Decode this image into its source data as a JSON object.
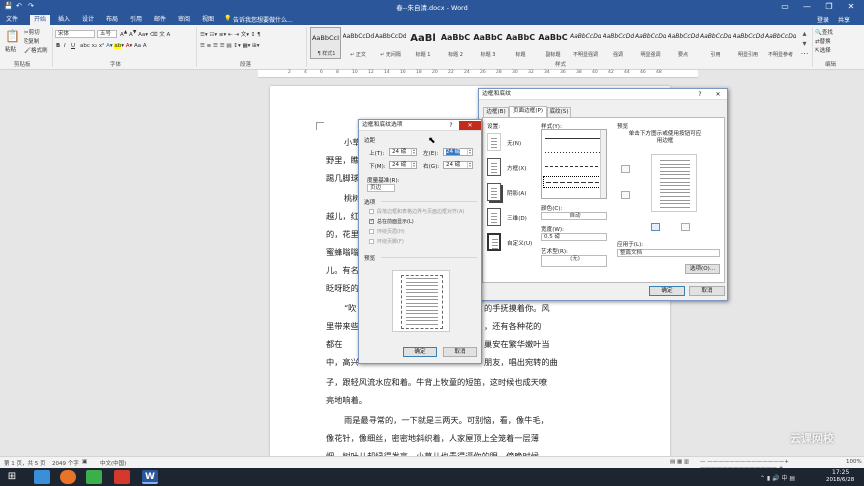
{
  "titlebar": {
    "title": "春--朱自清.docx - Word",
    "quick_access": [
      "💾",
      "↶",
      "↷"
    ],
    "window_buttons": [
      "▭",
      "—",
      "❐",
      "✕"
    ]
  },
  "tabs": [
    {
      "label": "文件"
    },
    {
      "label": "开始",
      "active": true
    },
    {
      "label": "插入"
    },
    {
      "label": "设计"
    },
    {
      "label": "布局"
    },
    {
      "label": "引用"
    },
    {
      "label": "邮件"
    },
    {
      "label": "审阅"
    },
    {
      "label": "视图"
    }
  ],
  "tellme": "告诉我您想要做什么...",
  "user": {
    "login": "登录",
    "share": "共享"
  },
  "ribbon": {
    "clipboard": {
      "paste": "粘贴",
      "cut": "剪切",
      "copy": "复制",
      "format_painter": "格式刷",
      "group": "剪贴板"
    },
    "font": {
      "name": "宋体",
      "size": "五号",
      "group": "字体",
      "bold": "B",
      "italic": "I",
      "underline": "U"
    },
    "paragraph": {
      "group": "段落"
    },
    "styles": {
      "group": "样式",
      "items": [
        {
          "preview": "AaBbCcI",
          "name": "¶ 样式1"
        },
        {
          "preview": "AaBbCcDd",
          "name": "↵ 正文"
        },
        {
          "preview": "AaBbCcDd",
          "name": "↵ 无间隔"
        },
        {
          "preview": "AaBl",
          "name": "标题 1"
        },
        {
          "preview": "AaBbC",
          "name": "标题 2"
        },
        {
          "preview": "AaBbC",
          "name": "标题 3"
        },
        {
          "preview": "AaBbC",
          "name": "标题"
        },
        {
          "preview": "AaBbC",
          "name": "副标题"
        },
        {
          "preview": "AaBbCcDd",
          "name": "不明显强调"
        },
        {
          "preview": "AaBbCcDd",
          "name": "强调"
        },
        {
          "preview": "AaBbCcDd",
          "name": "明显强调"
        },
        {
          "preview": "AaBbCcDd",
          "name": "要点"
        },
        {
          "preview": "AaBbCcDd",
          "name": "引用"
        },
        {
          "preview": "AaBbCcDd",
          "name": "明显引用"
        },
        {
          "preview": "AaBbCcDd",
          "name": "不明显参考"
        }
      ]
    },
    "editing": {
      "find": "查找",
      "replace": "替换",
      "select": "选择",
      "group": "编辑"
    }
  },
  "ruler_numbers": [
    "2",
    "4",
    "6",
    "8",
    "10",
    "12",
    "14",
    "16",
    "18",
    "20",
    "22",
    "24",
    "26",
    "28",
    "30",
    "32",
    "34",
    "36",
    "38",
    "40",
    "42",
    "44",
    "46",
    "48"
  ],
  "document_lines": [
    "小草",
    "野里，瞧",
    "踢几脚球",
    "桃树",
    "越儿，红",
    "的，花里",
    "蜜蜂嗡嗡",
    "儿。有名",
    "眨呀眨的",
    "“吹",
    "里带来些",
    "都在",
    "中，高兴",
    "子，跟轻风流水应和着。牛背上牧童的短笛，这时候也成天嘹",
    "亮地响着。",
    "雨是最寻常的，一下就是三两天。可别恼，看，像牛毛，",
    "像花针，像细丝，密密地斜织着，人家屋顶上全笼着一层薄",
    "烟。树叶儿却绿得发亮，小草儿也青得逼你的眼。傍晚时候，"
  ],
  "document_right_fragments": [
    "的手抚摸着你。风",
    "，还有各种花的",
    "巢安在繁华嫩叶当",
    "朋友，唱出宛转的曲"
  ],
  "statusbar": {
    "page": "第 1 页，共 5 页",
    "words": "2049 个字",
    "lang": "中文(中国)",
    "zoom": "100%"
  },
  "taskbar": {
    "time": "17:25",
    "date": "2018/6/28"
  },
  "watermark": "云课网校",
  "dialog_borders": {
    "title": "边框和底纹",
    "tabs": [
      {
        "label": "边框(B)"
      },
      {
        "label": "页面边框(P)",
        "active": true
      },
      {
        "label": "底纹(S)"
      }
    ],
    "setting_label": "设置:",
    "settings": [
      {
        "label": "无(N)"
      },
      {
        "label": "方框(X)"
      },
      {
        "label": "阴影(A)"
      },
      {
        "label": "三维(D)"
      },
      {
        "label": "自定义(U)"
      }
    ],
    "style_label": "样式(Y):",
    "color_label": "颜色(C):",
    "color_value": "自动",
    "width_label": "宽度(W):",
    "width_value": "0.5 磅",
    "art_label": "艺术型(R):",
    "art_value": "(无)",
    "preview_label": "预览",
    "preview_hint": "单击下方图示或使用按钮可应用边框",
    "apply_label": "应用于(L):",
    "apply_value": "整篇文档",
    "options_button": "选项(O)...",
    "ok_button": "确定",
    "cancel_button": "取消"
  },
  "dialog_options": {
    "title": "边框和底纹选项",
    "margin_label": "边距",
    "top_label": "上(T):",
    "top_value": "24 磅",
    "left_label": "左(E):",
    "left_value": "24 磅",
    "bottom_label": "下(M):",
    "bottom_value": "24 磅",
    "right_label": "右(G):",
    "right_value": "24 磅",
    "measure_label": "度量基准(R):",
    "measure_value": "页边",
    "options_label": "选项",
    "checkboxes": [
      {
        "label": "段落边框和表格边界与页面边框对齐(A)",
        "checked": false,
        "disabled": true
      },
      {
        "label": "总在前面显示(L)",
        "checked": true,
        "disabled": false
      },
      {
        "label": "环绕页眉(H)",
        "checked": false,
        "disabled": true
      },
      {
        "label": "环绕页脚(F)",
        "checked": false,
        "disabled": true
      }
    ],
    "preview_label": "预览",
    "ok_button": "确定",
    "cancel_button": "取消"
  }
}
